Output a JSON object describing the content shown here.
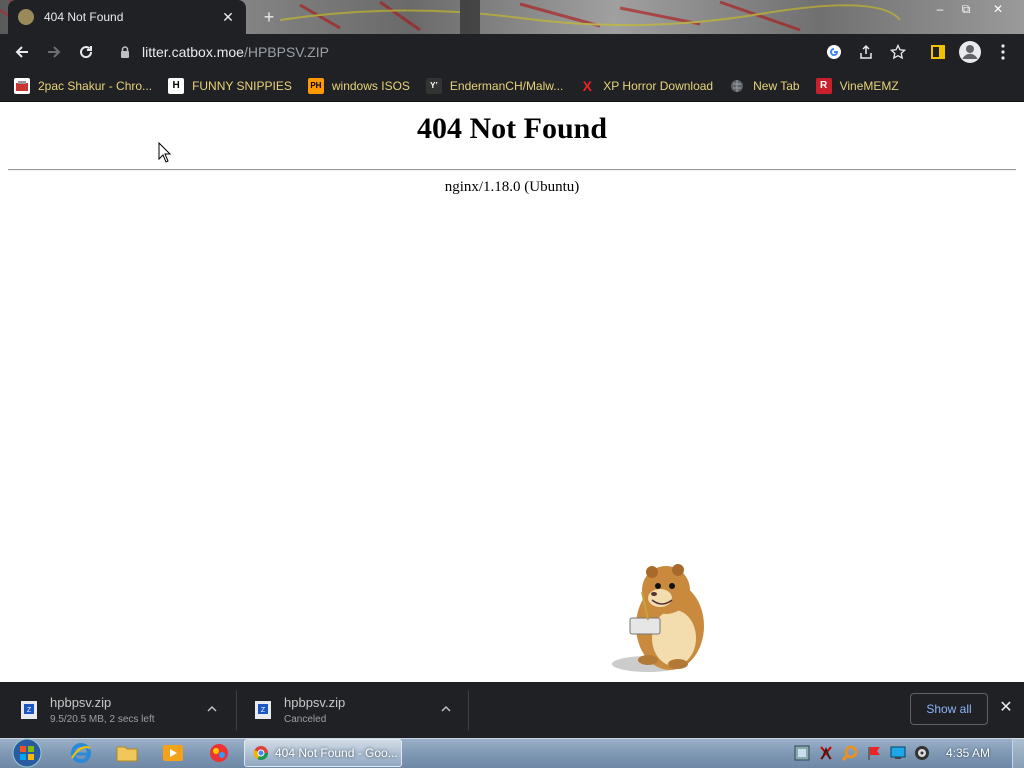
{
  "tab": {
    "title": "404 Not Found"
  },
  "window": {
    "minimize": "–",
    "restore": "⧉",
    "close": "✕"
  },
  "toolbar": {
    "url_host": "litter.catbox.moe",
    "url_path": "/HPBPSV.ZIP"
  },
  "bookmarks": [
    {
      "label": "2pac Shakur - Chro...",
      "icon": "youtube-like-icon"
    },
    {
      "label": "FUNNY SNIPPIES",
      "icon": "h-icon",
      "glyph": "H"
    },
    {
      "label": "windows ISOS",
      "icon": "ph-icon",
      "glyph": "PH"
    },
    {
      "label": "EndermanCH/Malw...",
      "icon": "yp-icon",
      "glyph": "Y’"
    },
    {
      "label": "XP Horror Download",
      "icon": "x-icon",
      "glyph": "X"
    },
    {
      "label": "New Tab",
      "icon": "globe-icon"
    },
    {
      "label": "VineMEMZ",
      "icon": "r-icon",
      "glyph": "R"
    }
  ],
  "page": {
    "heading": "404 Not Found",
    "server": "nginx/1.18.0 (Ubuntu)"
  },
  "downloads": [
    {
      "name": "hpbpsv.zip",
      "status": "9.5/20.5 MB, 2 secs left"
    },
    {
      "name": "hpbpsv.zip",
      "status": "Canceled"
    }
  ],
  "shelf": {
    "show_all": "Show all"
  },
  "taskbar": {
    "chrome_label": "404 Not Found - Goo...",
    "clock": "4:35 AM"
  },
  "colors": {
    "chrome_dark": "#202124",
    "bookmark_text": "#e8d37a",
    "link_blue": "#8ab4f8"
  }
}
